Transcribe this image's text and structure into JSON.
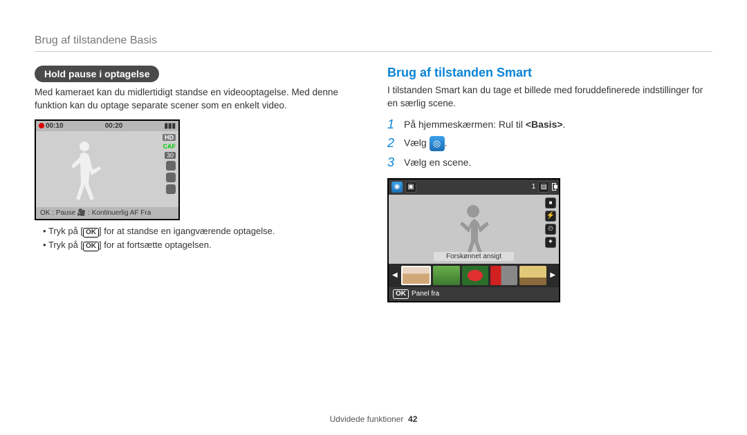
{
  "header": {
    "title": "Brug af tilstandene Basis"
  },
  "left": {
    "pill": "Hold pause i optagelse",
    "intro": "Med kameraet kan du midlertidigt standse en videooptagelse. Med denne funktion kan du optage separate scener som en enkelt video.",
    "screen": {
      "time_elapsed": "00:10",
      "time_total": "00:20",
      "caf": "CAF",
      "hd": "HD",
      "fps": "30",
      "bottom": "OK : Pause   🎥 : Kontinuerlig AF Fra"
    },
    "bullets": {
      "b1_prefix": "Tryk på [",
      "b1_ok": "OK",
      "b1_suffix": "] for at standse en igangværende optagelse.",
      "b2_prefix": "Tryk på [",
      "b2_ok": "OK",
      "b2_suffix": "] for at fortsætte optagelsen."
    }
  },
  "right": {
    "heading": "Brug af tilstanden Smart",
    "intro": "I tilstanden Smart kan du tage et billede med foruddefinerede indstillinger for en særlig scene.",
    "steps": {
      "s1_n": "1",
      "s1_text": "På hjemmeskærmen: Rul til ",
      "s1_bold": "<Basis>",
      "s1_suffix": ".",
      "s2_n": "2",
      "s2_text": "Vælg ",
      "s2_suffix": ".",
      "s3_n": "3",
      "s3_text": "Vælg en scene."
    },
    "screen": {
      "top_counter": "1",
      "label": "Forskønnet ansigt",
      "bottom_ok": "OK",
      "bottom_text": "Panel fra"
    }
  },
  "footer": {
    "section": "Udvidede funktioner",
    "page": "42"
  }
}
